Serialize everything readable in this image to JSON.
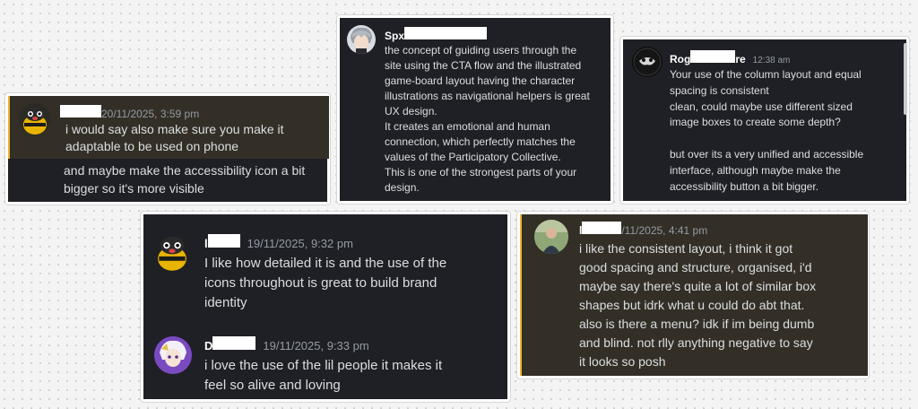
{
  "cards": {
    "c1": {
      "hl": {
        "name": "",
        "timestamp": "20/11/2025, 3:59 pm",
        "lines": [
          "i would say also make sure you  make it",
          "adaptable to be used on phone"
        ]
      },
      "cont": {
        "lines": [
          "and maybe make the accessibility icon a bit",
          "bigger so it's more visible"
        ]
      }
    },
    "c2": {
      "name": "Spx",
      "lines": [
        "the concept of guiding users through the",
        "site using the CTA flow and the illustrated",
        "game-board layout having the character",
        "illustrations as navigational helpers is great",
        "UX design.",
        "It creates an emotional and human",
        "connection, which perfectly matches the",
        "values of the Participatory Collective.",
        "This is one of the strongest parts of your",
        "design."
      ]
    },
    "c3": {
      "name_start": "Rog",
      "name_end": "re",
      "timestamp": "12:38 am",
      "lines": [
        "Your use of the column layout and equal",
        "spacing is consistent",
        "clean, could maybe use different sized",
        "image boxes to create some depth?",
        "",
        "but over its a very unified and accessible",
        "interface, although maybe make the",
        "accessibility button a bit bigger."
      ]
    },
    "c4": {
      "m1": {
        "name": "l",
        "timestamp": "19/11/2025, 9:32 pm",
        "lines": [
          "I like how detailed it is and the use of the",
          "icons throughout is great to build brand",
          "identity"
        ]
      },
      "m2": {
        "name": "D",
        "timestamp": "19/11/2025, 9:33 pm",
        "lines": [
          "i love the use of the lil people it makes it",
          "feel so alive and loving"
        ]
      }
    },
    "c5": {
      "name": "l",
      "timestamp": "/11/2025, 4:41 pm",
      "lines": [
        "i like the consistent layout, i think it got",
        "good spacing and structure, organised, i'd",
        "maybe say there's quite a lot of similar box",
        "shapes but idrk what u could do abt that.",
        "also is there a menu? idk if im being dumb",
        "and blind. not rlly anything negative to say",
        "it looks so posh"
      ]
    }
  },
  "colors": {
    "card_bg": "#1f2025",
    "highlight_bg": "#332f27",
    "highlight_bar": "#f0b232",
    "text": "#dbdee1",
    "timestamp": "#949ba4"
  },
  "icons": [
    "bee-mascot-avatar",
    "grey-hair-anime-avatar",
    "dark-mask-avatar",
    "purple-anime-avatar",
    "person-photo-avatar"
  ]
}
